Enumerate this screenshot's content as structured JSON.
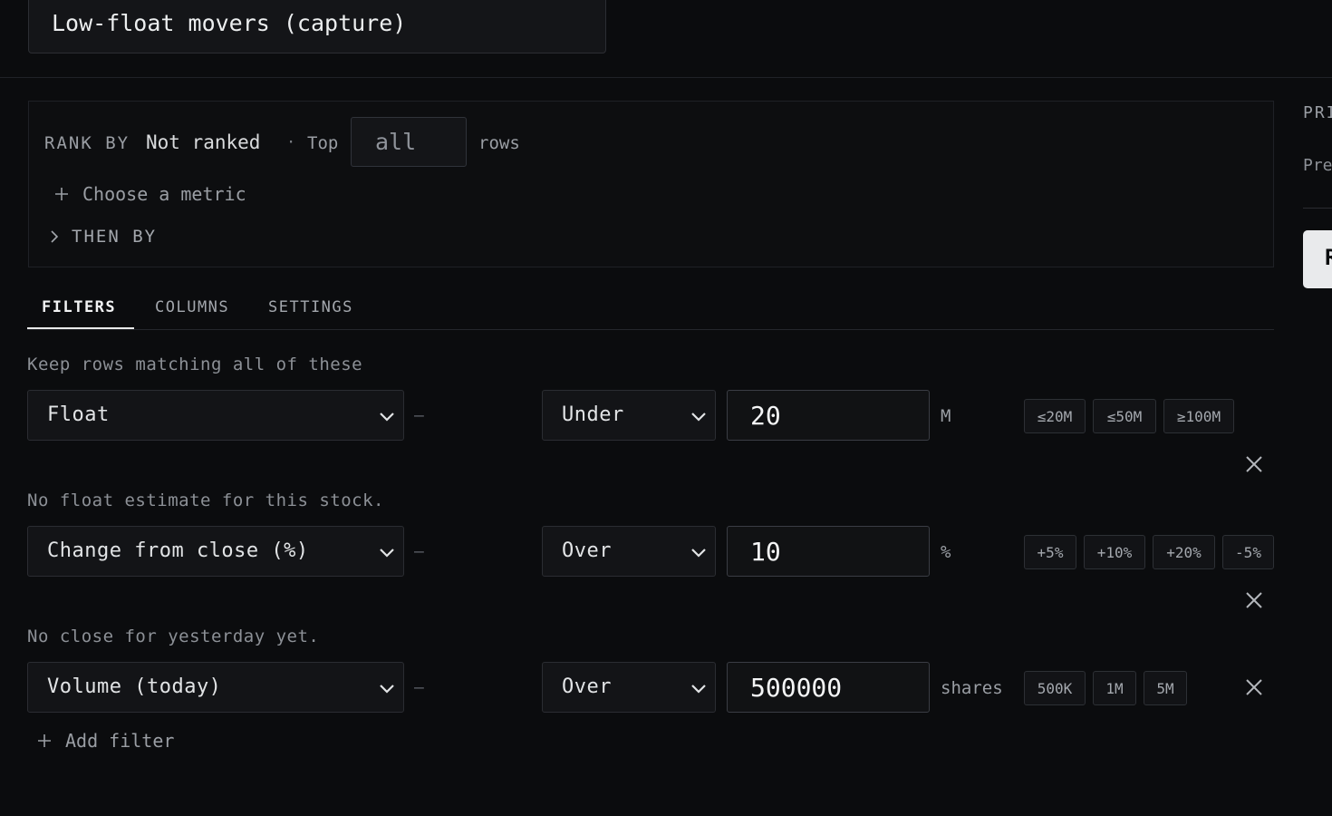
{
  "header": {
    "title": "Low-float movers (capture)"
  },
  "rank": {
    "rank_by_label": "RANK BY",
    "rank_by_value": "Not ranked",
    "separator": "·",
    "top_label": "Top",
    "top_value": "all",
    "rows_label": "rows",
    "choose_metric_label": "Choose a metric",
    "then_by_label": "THEN BY"
  },
  "tabs": [
    {
      "label": "FILTERS",
      "active": true
    },
    {
      "label": "COLUMNS",
      "active": false
    },
    {
      "label": "SETTINGS",
      "active": false
    }
  ],
  "filters": {
    "caption": "Keep rows matching all of these",
    "dash": "–",
    "items": [
      {
        "metric": "Float",
        "operator": "Under",
        "value": "20",
        "unit": "M",
        "chips": [
          "≤20M",
          "≤50M",
          "≥100M"
        ],
        "note": "No float estimate for this stock."
      },
      {
        "metric": "Change from close (%)",
        "operator": "Over",
        "value": "10",
        "unit": "%",
        "chips": [
          "+5%",
          "+10%",
          "+20%",
          "-5%"
        ],
        "note": "No close for yesterday yet."
      },
      {
        "metric": "Volume (today)",
        "operator": "Over",
        "value": "500000",
        "unit": "shares",
        "chips": [
          "500K",
          "1M",
          "5M"
        ],
        "note": ""
      }
    ],
    "add_filter_label": "Add filter"
  },
  "right_panel": {
    "heading": "PRI",
    "subtext": "Pre",
    "button_label": "R"
  },
  "icons": {
    "plus": "plus-icon",
    "chevron_right": "chevron-right-icon",
    "chevron_down": "chevron-down-icon",
    "close": "close-icon"
  },
  "colors": {
    "background": "#0b0c0e",
    "panel": "#131417",
    "border": "#2b2d32",
    "text": "#e2e4e6",
    "muted": "#9a9ea4",
    "active_tab": "#f2f3f4"
  }
}
